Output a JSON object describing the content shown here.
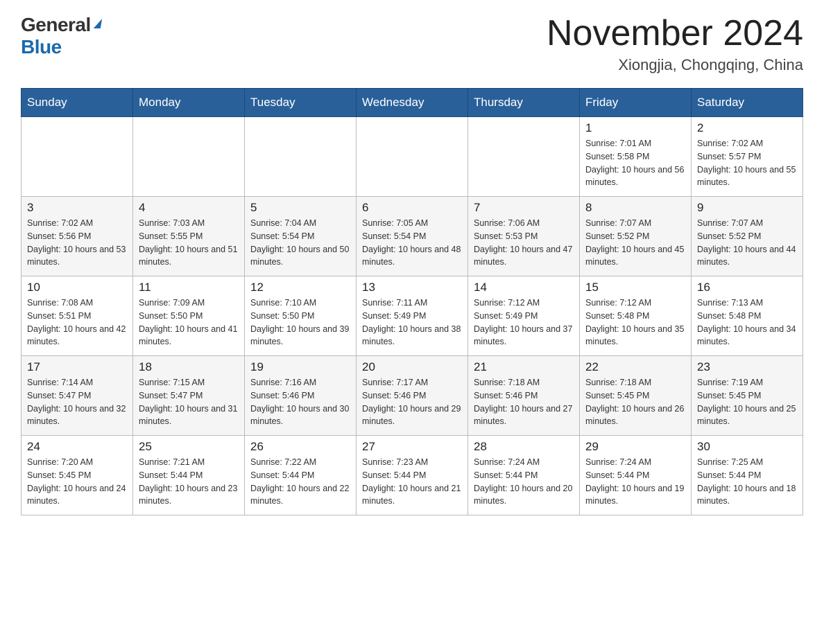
{
  "logo": {
    "general": "General",
    "blue": "Blue"
  },
  "header": {
    "month_year": "November 2024",
    "location": "Xiongjia, Chongqing, China"
  },
  "days_of_week": [
    "Sunday",
    "Monday",
    "Tuesday",
    "Wednesday",
    "Thursday",
    "Friday",
    "Saturday"
  ],
  "weeks": [
    [
      {
        "day": "",
        "sunrise": "",
        "sunset": "",
        "daylight": ""
      },
      {
        "day": "",
        "sunrise": "",
        "sunset": "",
        "daylight": ""
      },
      {
        "day": "",
        "sunrise": "",
        "sunset": "",
        "daylight": ""
      },
      {
        "day": "",
        "sunrise": "",
        "sunset": "",
        "daylight": ""
      },
      {
        "day": "",
        "sunrise": "",
        "sunset": "",
        "daylight": ""
      },
      {
        "day": "1",
        "sunrise": "Sunrise: 7:01 AM",
        "sunset": "Sunset: 5:58 PM",
        "daylight": "Daylight: 10 hours and 56 minutes."
      },
      {
        "day": "2",
        "sunrise": "Sunrise: 7:02 AM",
        "sunset": "Sunset: 5:57 PM",
        "daylight": "Daylight: 10 hours and 55 minutes."
      }
    ],
    [
      {
        "day": "3",
        "sunrise": "Sunrise: 7:02 AM",
        "sunset": "Sunset: 5:56 PM",
        "daylight": "Daylight: 10 hours and 53 minutes."
      },
      {
        "day": "4",
        "sunrise": "Sunrise: 7:03 AM",
        "sunset": "Sunset: 5:55 PM",
        "daylight": "Daylight: 10 hours and 51 minutes."
      },
      {
        "day": "5",
        "sunrise": "Sunrise: 7:04 AM",
        "sunset": "Sunset: 5:54 PM",
        "daylight": "Daylight: 10 hours and 50 minutes."
      },
      {
        "day": "6",
        "sunrise": "Sunrise: 7:05 AM",
        "sunset": "Sunset: 5:54 PM",
        "daylight": "Daylight: 10 hours and 48 minutes."
      },
      {
        "day": "7",
        "sunrise": "Sunrise: 7:06 AM",
        "sunset": "Sunset: 5:53 PM",
        "daylight": "Daylight: 10 hours and 47 minutes."
      },
      {
        "day": "8",
        "sunrise": "Sunrise: 7:07 AM",
        "sunset": "Sunset: 5:52 PM",
        "daylight": "Daylight: 10 hours and 45 minutes."
      },
      {
        "day": "9",
        "sunrise": "Sunrise: 7:07 AM",
        "sunset": "Sunset: 5:52 PM",
        "daylight": "Daylight: 10 hours and 44 minutes."
      }
    ],
    [
      {
        "day": "10",
        "sunrise": "Sunrise: 7:08 AM",
        "sunset": "Sunset: 5:51 PM",
        "daylight": "Daylight: 10 hours and 42 minutes."
      },
      {
        "day": "11",
        "sunrise": "Sunrise: 7:09 AM",
        "sunset": "Sunset: 5:50 PM",
        "daylight": "Daylight: 10 hours and 41 minutes."
      },
      {
        "day": "12",
        "sunrise": "Sunrise: 7:10 AM",
        "sunset": "Sunset: 5:50 PM",
        "daylight": "Daylight: 10 hours and 39 minutes."
      },
      {
        "day": "13",
        "sunrise": "Sunrise: 7:11 AM",
        "sunset": "Sunset: 5:49 PM",
        "daylight": "Daylight: 10 hours and 38 minutes."
      },
      {
        "day": "14",
        "sunrise": "Sunrise: 7:12 AM",
        "sunset": "Sunset: 5:49 PM",
        "daylight": "Daylight: 10 hours and 37 minutes."
      },
      {
        "day": "15",
        "sunrise": "Sunrise: 7:12 AM",
        "sunset": "Sunset: 5:48 PM",
        "daylight": "Daylight: 10 hours and 35 minutes."
      },
      {
        "day": "16",
        "sunrise": "Sunrise: 7:13 AM",
        "sunset": "Sunset: 5:48 PM",
        "daylight": "Daylight: 10 hours and 34 minutes."
      }
    ],
    [
      {
        "day": "17",
        "sunrise": "Sunrise: 7:14 AM",
        "sunset": "Sunset: 5:47 PM",
        "daylight": "Daylight: 10 hours and 32 minutes."
      },
      {
        "day": "18",
        "sunrise": "Sunrise: 7:15 AM",
        "sunset": "Sunset: 5:47 PM",
        "daylight": "Daylight: 10 hours and 31 minutes."
      },
      {
        "day": "19",
        "sunrise": "Sunrise: 7:16 AM",
        "sunset": "Sunset: 5:46 PM",
        "daylight": "Daylight: 10 hours and 30 minutes."
      },
      {
        "day": "20",
        "sunrise": "Sunrise: 7:17 AM",
        "sunset": "Sunset: 5:46 PM",
        "daylight": "Daylight: 10 hours and 29 minutes."
      },
      {
        "day": "21",
        "sunrise": "Sunrise: 7:18 AM",
        "sunset": "Sunset: 5:46 PM",
        "daylight": "Daylight: 10 hours and 27 minutes."
      },
      {
        "day": "22",
        "sunrise": "Sunrise: 7:18 AM",
        "sunset": "Sunset: 5:45 PM",
        "daylight": "Daylight: 10 hours and 26 minutes."
      },
      {
        "day": "23",
        "sunrise": "Sunrise: 7:19 AM",
        "sunset": "Sunset: 5:45 PM",
        "daylight": "Daylight: 10 hours and 25 minutes."
      }
    ],
    [
      {
        "day": "24",
        "sunrise": "Sunrise: 7:20 AM",
        "sunset": "Sunset: 5:45 PM",
        "daylight": "Daylight: 10 hours and 24 minutes."
      },
      {
        "day": "25",
        "sunrise": "Sunrise: 7:21 AM",
        "sunset": "Sunset: 5:44 PM",
        "daylight": "Daylight: 10 hours and 23 minutes."
      },
      {
        "day": "26",
        "sunrise": "Sunrise: 7:22 AM",
        "sunset": "Sunset: 5:44 PM",
        "daylight": "Daylight: 10 hours and 22 minutes."
      },
      {
        "day": "27",
        "sunrise": "Sunrise: 7:23 AM",
        "sunset": "Sunset: 5:44 PM",
        "daylight": "Daylight: 10 hours and 21 minutes."
      },
      {
        "day": "28",
        "sunrise": "Sunrise: 7:24 AM",
        "sunset": "Sunset: 5:44 PM",
        "daylight": "Daylight: 10 hours and 20 minutes."
      },
      {
        "day": "29",
        "sunrise": "Sunrise: 7:24 AM",
        "sunset": "Sunset: 5:44 PM",
        "daylight": "Daylight: 10 hours and 19 minutes."
      },
      {
        "day": "30",
        "sunrise": "Sunrise: 7:25 AM",
        "sunset": "Sunset: 5:44 PM",
        "daylight": "Daylight: 10 hours and 18 minutes."
      }
    ]
  ]
}
